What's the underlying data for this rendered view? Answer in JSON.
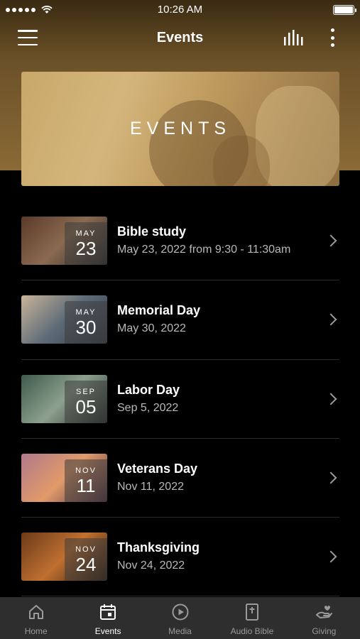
{
  "status_bar": {
    "time": "10:26 AM"
  },
  "header": {
    "title": "Events"
  },
  "banner": {
    "text": "EVENTS"
  },
  "events": [
    {
      "month": "MAY",
      "day": "23",
      "title": "Bible study",
      "date": "May 23, 2022 from 9:30 - 11:30am",
      "thumb_colors": [
        "#5a3a28",
        "#8a6a50",
        "#2a2a2a"
      ]
    },
    {
      "month": "MAY",
      "day": "30",
      "title": "Memorial Day",
      "date": "May 30, 2022",
      "thumb_colors": [
        "#c9b49a",
        "#5d6b78",
        "#2f3b44"
      ]
    },
    {
      "month": "SEP",
      "day": "05",
      "title": "Labor Day",
      "date": "Sep 5, 2022",
      "thumb_colors": [
        "#3e5a4a",
        "#8da08f",
        "#1f2e25"
      ]
    },
    {
      "month": "NOV",
      "day": "11",
      "title": "Veterans Day",
      "date": "Nov 11, 2022",
      "thumb_colors": [
        "#b07a8a",
        "#e29a6a",
        "#4a3040"
      ]
    },
    {
      "month": "NOV",
      "day": "24",
      "title": "Thanksgiving",
      "date": "Nov 24, 2022",
      "thumb_colors": [
        "#6a3a1a",
        "#c07030",
        "#2a1a10"
      ]
    }
  ],
  "tabs": [
    {
      "label": "Home",
      "icon": "home-icon",
      "active": false
    },
    {
      "label": "Events",
      "icon": "calendar-icon",
      "active": true
    },
    {
      "label": "Media",
      "icon": "play-icon",
      "active": false
    },
    {
      "label": "Audio Bible",
      "icon": "bible-icon",
      "active": false
    },
    {
      "label": "Giving",
      "icon": "giving-icon",
      "active": false
    }
  ]
}
